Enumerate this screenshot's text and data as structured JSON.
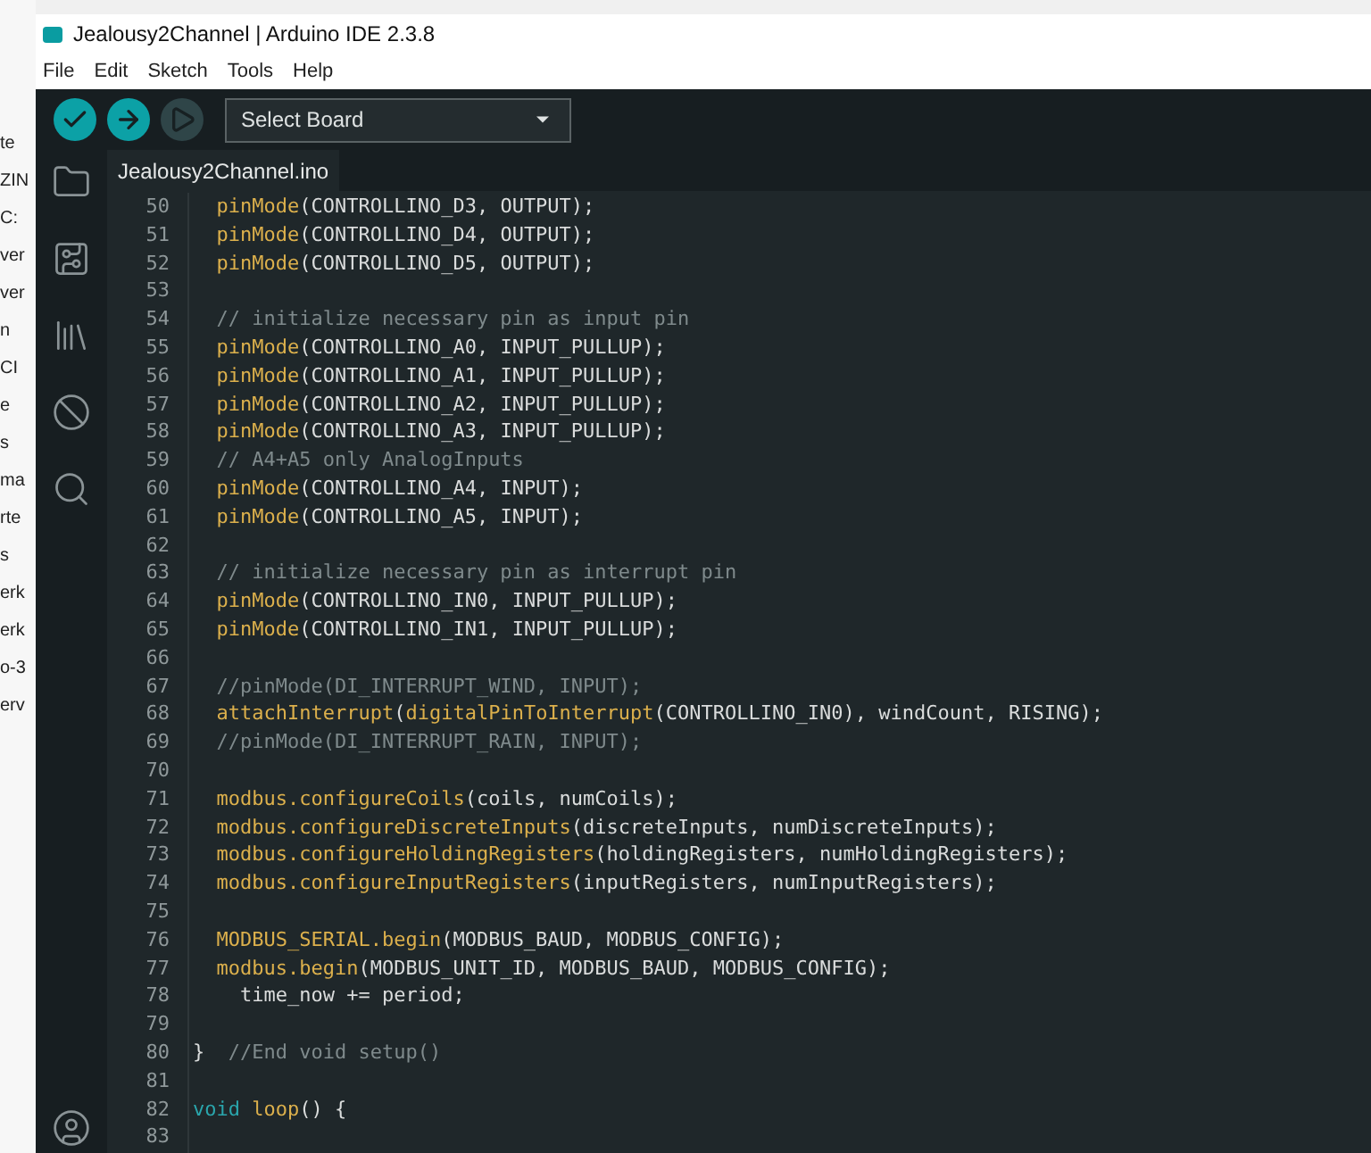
{
  "background_window": {
    "fragments": [
      "te",
      "ZIN",
      "C:",
      "ver",
      "ver",
      "n",
      "CI",
      "e",
      "s",
      "ma",
      "rte",
      "s",
      "erk",
      "erk",
      "o-3",
      "erv"
    ]
  },
  "window": {
    "title": "Jealousy2Channel | Arduino IDE 2.3.8"
  },
  "menu": [
    "File",
    "Edit",
    "Sketch",
    "Tools",
    "Help"
  ],
  "toolbar": {
    "buttons": [
      {
        "kind": "verify",
        "disabled": false
      },
      {
        "kind": "upload",
        "disabled": false
      },
      {
        "kind": "debug",
        "disabled": true
      }
    ],
    "board_select": {
      "value": "Select Board"
    }
  },
  "sidebar": {
    "items": [
      {
        "kind": "folder",
        "selected": false
      },
      {
        "kind": "board",
        "selected": false
      },
      {
        "kind": "library",
        "selected": false
      },
      {
        "kind": "debug",
        "selected": false
      },
      {
        "kind": "search",
        "selected": false
      }
    ],
    "account": {
      "kind": "account"
    }
  },
  "tabs": [
    {
      "label": "Jealousy2Channel.ino",
      "selected": true
    }
  ],
  "editor": {
    "lines": [
      {
        "number": "50",
        "tokens": [
          {
            "kind": "fn",
            "text": "  pinMode"
          },
          {
            "kind": "plain",
            "text": "(CONTROLLINO_D3, OUTPUT);"
          }
        ]
      },
      {
        "number": "51",
        "tokens": [
          {
            "kind": "fn",
            "text": "  pinMode"
          },
          {
            "kind": "plain",
            "text": "(CONTROLLINO_D4, OUTPUT);"
          }
        ]
      },
      {
        "number": "52",
        "tokens": [
          {
            "kind": "fn",
            "text": "  pinMode"
          },
          {
            "kind": "plain",
            "text": "(CONTROLLINO_D5, OUTPUT);"
          }
        ]
      },
      {
        "number": "53"
      },
      {
        "number": "54",
        "tokens": [
          {
            "kind": "comment",
            "text": "  // initialize necessary pin as input pin"
          }
        ]
      },
      {
        "number": "55",
        "tokens": [
          {
            "kind": "fn",
            "text": "  pinMode"
          },
          {
            "kind": "plain",
            "text": "(CONTROLLINO_A0, INPUT_PULLUP);"
          }
        ]
      },
      {
        "number": "56",
        "tokens": [
          {
            "kind": "fn",
            "text": "  pinMode"
          },
          {
            "kind": "plain",
            "text": "(CONTROLLINO_A1, INPUT_PULLUP);"
          }
        ]
      },
      {
        "number": "57",
        "tokens": [
          {
            "kind": "fn",
            "text": "  pinMode"
          },
          {
            "kind": "plain",
            "text": "(CONTROLLINO_A2, INPUT_PULLUP);"
          }
        ]
      },
      {
        "number": "58",
        "tokens": [
          {
            "kind": "fn",
            "text": "  pinMode"
          },
          {
            "kind": "plain",
            "text": "(CONTROLLINO_A3, INPUT_PULLUP);"
          }
        ]
      },
      {
        "number": "59",
        "tokens": [
          {
            "kind": "comment",
            "text": "  // A4+A5 only AnalogInputs"
          }
        ]
      },
      {
        "number": "60",
        "tokens": [
          {
            "kind": "fn",
            "text": "  pinMode"
          },
          {
            "kind": "plain",
            "text": "(CONTROLLINO_A4, INPUT);"
          }
        ]
      },
      {
        "number": "61",
        "tokens": [
          {
            "kind": "fn",
            "text": "  pinMode"
          },
          {
            "kind": "plain",
            "text": "(CONTROLLINO_A5, INPUT);"
          }
        ]
      },
      {
        "number": "62"
      },
      {
        "number": "63",
        "tokens": [
          {
            "kind": "comment",
            "text": "  // initialize necessary pin as interrupt pin"
          }
        ]
      },
      {
        "number": "64",
        "tokens": [
          {
            "kind": "fn",
            "text": "  pinMode"
          },
          {
            "kind": "plain",
            "text": "(CONTROLLINO_IN0, INPUT_PULLUP);"
          }
        ]
      },
      {
        "number": "65",
        "tokens": [
          {
            "kind": "fn",
            "text": "  pinMode"
          },
          {
            "kind": "plain",
            "text": "(CONTROLLINO_IN1, INPUT_PULLUP);"
          }
        ]
      },
      {
        "number": "66"
      },
      {
        "number": "67",
        "tokens": [
          {
            "kind": "comment",
            "text": "  //pinMode(DI_INTERRUPT_WIND, INPUT);"
          }
        ]
      },
      {
        "number": "68",
        "tokens": [
          {
            "kind": "fn",
            "text": "  attachInterrupt"
          },
          {
            "kind": "plain",
            "text": "("
          },
          {
            "kind": "fn",
            "text": "digitalPinToInterrupt"
          },
          {
            "kind": "plain",
            "text": "(CONTROLLINO_IN0), windCount, RISING);"
          }
        ]
      },
      {
        "number": "69",
        "tokens": [
          {
            "kind": "comment",
            "text": "  //pinMode(DI_INTERRUPT_RAIN, INPUT);"
          }
        ]
      },
      {
        "number": "70"
      },
      {
        "number": "71",
        "tokens": [
          {
            "kind": "fn",
            "text": "  modbus.configureCoils"
          },
          {
            "kind": "plain",
            "text": "(coils, numCoils);"
          }
        ]
      },
      {
        "number": "72",
        "tokens": [
          {
            "kind": "fn",
            "text": "  modbus.configureDiscreteInputs"
          },
          {
            "kind": "plain",
            "text": "(discreteInputs, numDiscreteInputs);"
          }
        ]
      },
      {
        "number": "73",
        "tokens": [
          {
            "kind": "fn",
            "text": "  modbus.configureHoldingRegisters"
          },
          {
            "kind": "plain",
            "text": "(holdingRegisters, numHoldingRegisters);"
          }
        ]
      },
      {
        "number": "74",
        "tokens": [
          {
            "kind": "fn",
            "text": "  modbus.configureInputRegisters"
          },
          {
            "kind": "plain",
            "text": "(inputRegisters, numInputRegisters);"
          }
        ]
      },
      {
        "number": "75"
      },
      {
        "number": "76",
        "tokens": [
          {
            "kind": "fn",
            "text": "  MODBUS_SERIAL.begin"
          },
          {
            "kind": "plain",
            "text": "(MODBUS_BAUD, MODBUS_CONFIG);"
          }
        ]
      },
      {
        "number": "77",
        "tokens": [
          {
            "kind": "fn",
            "text": "  modbus.begin"
          },
          {
            "kind": "plain",
            "text": "(MODBUS_UNIT_ID, MODBUS_BAUD, MODBUS_CONFIG);"
          }
        ]
      },
      {
        "number": "78",
        "tokens": [
          {
            "kind": "plain",
            "text": "    time_now += period;"
          }
        ]
      },
      {
        "number": "79"
      },
      {
        "number": "80",
        "tokens": [
          {
            "kind": "plain",
            "text": "}"
          },
          {
            "kind": "comment",
            "text": "  //End void setup()"
          }
        ]
      },
      {
        "number": "81"
      },
      {
        "number": "82",
        "tokens": [
          {
            "kind": "keyword",
            "text": "void"
          },
          {
            "kind": "fn",
            "text": " loop"
          },
          {
            "kind": "plain",
            "text": "() {"
          }
        ]
      },
      {
        "number": "83"
      }
    ]
  }
}
